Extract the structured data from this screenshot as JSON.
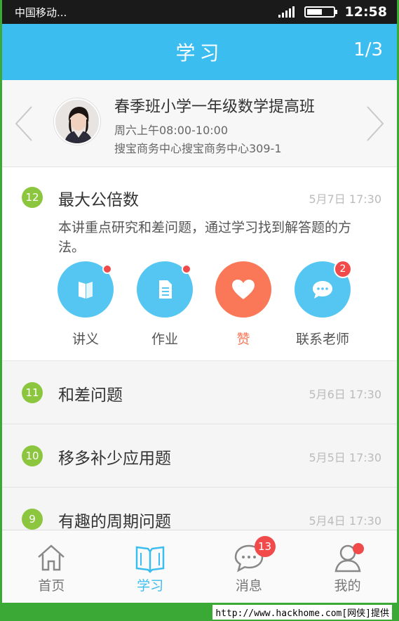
{
  "status": {
    "carrier": "中国移动...",
    "time": "12:58",
    "battery_level": 0.6
  },
  "header": {
    "title": "学习",
    "page_indicator": "1/3"
  },
  "class_card": {
    "name": "春季班小学一年级数学提高班",
    "schedule": "周六上午08:00-10:00",
    "address": "搜宝商务中心搜宝商务中心309-1"
  },
  "current_lesson": {
    "number": "12",
    "title": "最大公倍数",
    "date": "5月7日 17:30",
    "description": "本讲重点研究和差问题，通过学习找到解答题的方法。",
    "actions": [
      {
        "label": "讲义",
        "color": "#55c6f2",
        "icon": "book-icon"
      },
      {
        "label": "作业",
        "color": "#55c6f2",
        "icon": "document-icon"
      },
      {
        "label": "赞",
        "color": "#fa7757",
        "icon": "heart-icon"
      },
      {
        "label": "联系老师",
        "color": "#55c6f2",
        "icon": "chat-icon",
        "badge": "2"
      }
    ]
  },
  "lessons": [
    {
      "number": "11",
      "title": "和差问题",
      "date": "5月6日 17:30"
    },
    {
      "number": "10",
      "title": "移多补少应用题",
      "date": "5月5日 17:30"
    },
    {
      "number": "9",
      "title": "有趣的周期问题",
      "date": "5月4日 17:30"
    }
  ],
  "tabs": [
    {
      "label": "首页",
      "icon": "home-icon"
    },
    {
      "label": "学习",
      "icon": "open-book-icon",
      "active": true
    },
    {
      "label": "消息",
      "icon": "message-icon",
      "badge": "13"
    },
    {
      "label": "我的",
      "icon": "person-icon"
    }
  ],
  "footer": {
    "credit": "http://www.hackhome.com[网侠]提供"
  },
  "colors": {
    "primary": "#3cbdf0",
    "badge_green": "#8cc63f",
    "alert_red": "#f04a4a",
    "like_orange": "#fa7757"
  }
}
